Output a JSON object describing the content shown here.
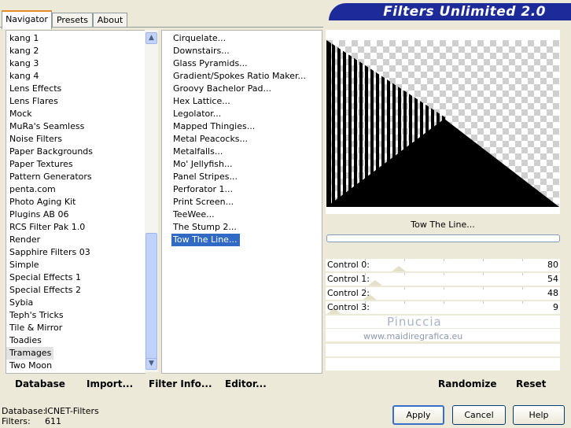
{
  "tabs": [
    "Navigator",
    "Presets",
    "About"
  ],
  "banner_title": "Filters Unlimited 2.0",
  "categories": [
    "kang 1",
    "kang 2",
    "kang 3",
    "kang 4",
    "Lens Effects",
    "Lens Flares",
    "Mock",
    "MuRa's Seamless",
    "Noise Filters",
    "Paper Backgrounds",
    "Paper Textures",
    "Pattern Generators",
    "penta.com",
    "Photo Aging Kit",
    "Plugins AB 06",
    "RCS Filter Pak 1.0",
    "Render",
    "Sapphire Filters 03",
    "Simple",
    "Special Effects 1",
    "Special Effects 2",
    "Sybia",
    "Teph's Tricks",
    "Tile & Mirror",
    "Toadies",
    "Tramages",
    "Two Moon"
  ],
  "selected_category": "Tramages",
  "filters": [
    "Cirquelate...",
    "Downstairs...",
    "Glass Pyramids...",
    "Gradient/Spokes Ratio Maker...",
    "Groovy Bachelor Pad...",
    "Hex Lattice...",
    "Legolator...",
    "Mapped Thingies...",
    "Metal Peacocks...",
    "Metalfalls...",
    "Mo' Jellyfish...",
    "Panel Stripes...",
    "Perforator 1...",
    "Print Screen...",
    "TeeWee...",
    "The Stump 2...",
    "Tow The Line..."
  ],
  "selected_filter": "Tow The Line...",
  "preview_filter_name": "Tow The Line...",
  "controls": [
    {
      "label": "Control 0:",
      "value": 80
    },
    {
      "label": "Control 1:",
      "value": 54
    },
    {
      "label": "Control 2:",
      "value": 48
    },
    {
      "label": "Control 3:",
      "value": 9
    }
  ],
  "watermark": {
    "name": "Pinuccia",
    "url": "www.maidiregrafica.eu"
  },
  "bottom_links": {
    "database": "Database",
    "import": "Import...",
    "filter_info": "Filter Info...",
    "editor": "Editor...",
    "randomize": "Randomize",
    "reset": "Reset"
  },
  "status": {
    "database_label": "Database:",
    "database_value": "ICNET-Filters",
    "filters_label": "Filters:",
    "filters_value": "611"
  },
  "buttons": {
    "apply": "Apply",
    "cancel": "Cancel",
    "help": "Help"
  }
}
